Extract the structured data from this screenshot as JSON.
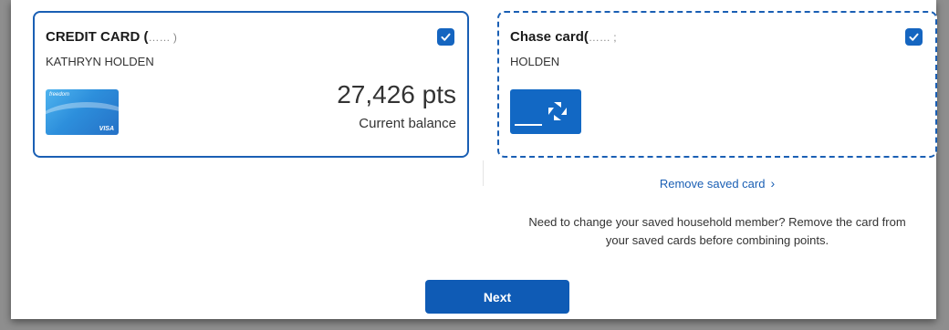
{
  "cards": [
    {
      "title": "CREDIT CARD (",
      "title_masked_tail": "…… )",
      "holder": "KATHRYN HOLDEN",
      "image": {
        "brand_text": "freedom",
        "network": "VISA"
      },
      "balance": "27,426 pts",
      "balance_label": "Current balance",
      "checked": true
    },
    {
      "title": "Chase card(",
      "title_masked_tail": "…… ;",
      "holder": "HOLDEN",
      "image": {
        "brand": "chase-logo"
      },
      "checked": true
    }
  ],
  "links": {
    "remove_saved_card": "Remove saved card",
    "remove_chevron": "›"
  },
  "note": {
    "line1": "Need to change your saved household member? Remove the card from",
    "line2": "your saved cards before combining points."
  },
  "buttons": {
    "next": "Next"
  },
  "colors": {
    "accent": "#1a5fb4",
    "button": "#0f5bb5",
    "backdrop": "#8e8e8e"
  }
}
